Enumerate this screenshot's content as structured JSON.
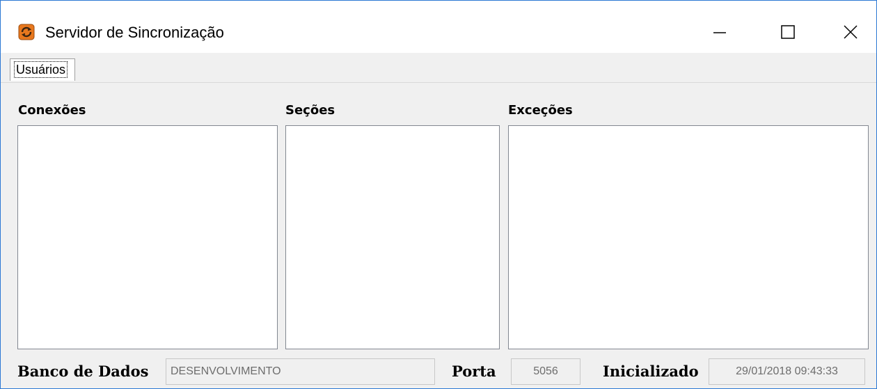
{
  "window": {
    "title": "Servidor de Sincronização",
    "icon": "sync-icon",
    "controls": [
      "minimize-icon",
      "maximize-icon",
      "close-icon"
    ]
  },
  "tabs": [
    {
      "label": "Usuários",
      "selected": true
    }
  ],
  "sections": {
    "conexoes": {
      "label": "Conexões"
    },
    "secoes": {
      "label": "Seções"
    },
    "excecoes": {
      "label": "Exceções"
    }
  },
  "footer": {
    "banco_label": "Banco de Dados",
    "banco_value": "DESENVOLVIMENTO",
    "porta_label": "Porta",
    "porta_value": "5056",
    "inicializado_label": "Inicializado",
    "inicializado_value": "29/01/2018 09:43:33"
  },
  "colors": {
    "window_border": "#2b78d4",
    "icon_orange": "#e8781e",
    "face": "#f0f0f0"
  }
}
